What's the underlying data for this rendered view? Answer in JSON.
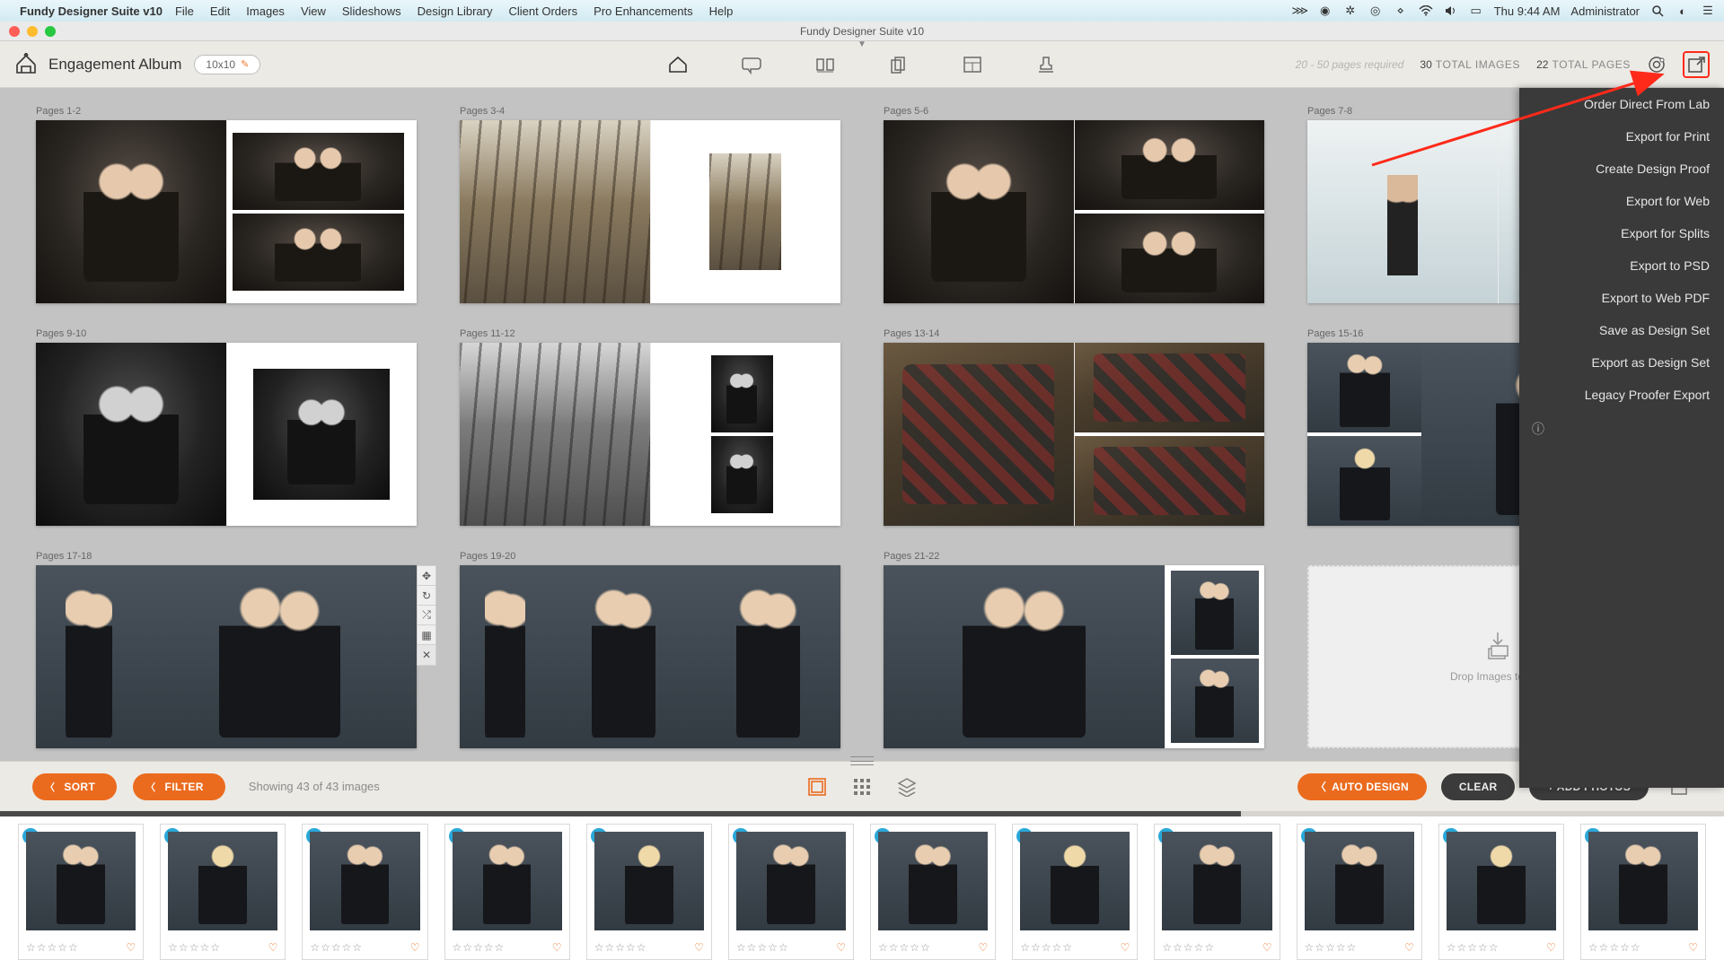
{
  "menubar": {
    "app_name": "Fundy Designer Suite v10",
    "items": [
      "File",
      "Edit",
      "Images",
      "View",
      "Slideshows",
      "Design Library",
      "Client Orders",
      "Pro Enhancements",
      "Help"
    ],
    "clock": "Thu 9:44 AM",
    "user": "Administrator"
  },
  "window": {
    "title": "Fundy Designer Suite v10"
  },
  "toolbar": {
    "project_name": "Engagement Album",
    "size_label": "10x10",
    "pages_required": "20 - 50 pages required",
    "total_images_n": "30",
    "total_images_lbl": "TOTAL IMAGES",
    "total_pages_n": "22",
    "total_pages_lbl": "TOTAL PAGES"
  },
  "export_menu": {
    "items": [
      "Order Direct From Lab",
      "Export for Print",
      "Create Design Proof",
      "Export for Web",
      "Export for Splits",
      "Export to PSD",
      "Export to Web PDF",
      "Save as Design Set",
      "Export as Design Set",
      "Legacy Proofer Export"
    ]
  },
  "spreads": [
    {
      "label": "Pages 1-2"
    },
    {
      "label": "Pages 3-4"
    },
    {
      "label": "Pages 5-6"
    },
    {
      "label": "Pages 7-8"
    },
    {
      "label": "Pages 9-10"
    },
    {
      "label": "Pages 11-12"
    },
    {
      "label": "Pages 13-14"
    },
    {
      "label": "Pages 15-16"
    },
    {
      "label": "Pages 17-18"
    },
    {
      "label": "Pages 19-20"
    },
    {
      "label": "Pages 21-22"
    }
  ],
  "dropzone": {
    "label": "Drop Images to Add"
  },
  "filterbar": {
    "sort": "SORT",
    "filter": "FILTER",
    "status": "Showing 43 of 43 images",
    "auto": "AUTO DESIGN",
    "clear": "CLEAR",
    "add": "+ ADD PHOTOS"
  },
  "thumbs": {
    "badge": "1",
    "stars": "☆☆☆☆☆",
    "heart": "♡",
    "count": 12
  }
}
